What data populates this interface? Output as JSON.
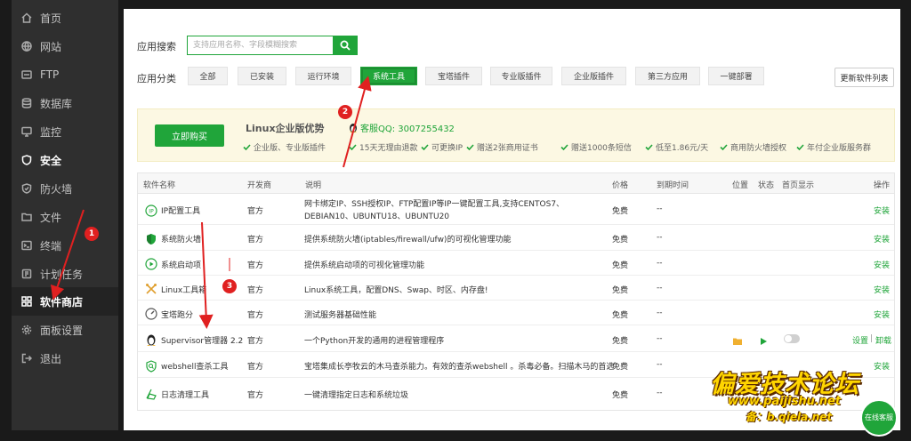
{
  "sidebar": {
    "items": [
      {
        "label": "首页",
        "icon": "home-icon"
      },
      {
        "label": "网站",
        "icon": "globe-icon"
      },
      {
        "label": "FTP",
        "icon": "ftp-icon"
      },
      {
        "label": "数据库",
        "icon": "database-icon"
      },
      {
        "label": "监控",
        "icon": "monitor-icon"
      },
      {
        "label": "安全",
        "icon": "shield-icon"
      },
      {
        "label": "防火墙",
        "icon": "firewall-icon"
      },
      {
        "label": "文件",
        "icon": "folder-icon"
      },
      {
        "label": "终端",
        "icon": "terminal-icon"
      },
      {
        "label": "计划任务",
        "icon": "clock-icon"
      },
      {
        "label": "软件商店",
        "icon": "apps-icon"
      },
      {
        "label": "面板设置",
        "icon": "gear-icon"
      },
      {
        "label": "退出",
        "icon": "logout-icon"
      }
    ],
    "active": "软件商店"
  },
  "search": {
    "label": "应用搜索",
    "placeholder": "支持应用名称、字段模糊搜索"
  },
  "categories": {
    "label": "应用分类",
    "items": [
      "全部",
      "已安装",
      "运行环境",
      "系统工具",
      "宝塔插件",
      "专业版插件",
      "企业版插件",
      "第三方应用",
      "一键部署"
    ],
    "active": "系统工具",
    "update_label": "更新软件列表"
  },
  "promo": {
    "buy_label": "立即购买",
    "title": "Linux企业版优势",
    "qq": "客服QQ: 3007255432",
    "features": [
      "企业版、专业版插件",
      "15天无理由退款",
      "可更换IP",
      "赠送2张商用证书",
      "赠送1000条短信",
      "低至1.86元/天",
      "商用防火墙授权",
      "年付企业版服务群"
    ]
  },
  "table": {
    "headers": [
      "软件名称",
      "开发商",
      "说明",
      "价格",
      "到期时间",
      "位置",
      "状态",
      "首页显示",
      "操作"
    ],
    "rows": [
      {
        "name": "IP配置工具",
        "dev": "官方",
        "desc": "网卡绑定IP、SSH授权IP、FTP配置IP等IP一键配置工具,支持CENTOS7、DEBIAN10、UBUNTU18、UBUNTU20",
        "price": "免费",
        "expire": "--",
        "op": "安装",
        "icon": "ip-icon"
      },
      {
        "name": "系统防火墙",
        "dev": "官方",
        "desc": "提供系统防火墙(iptables/firewall/ufw)的可视化管理功能",
        "price": "免费",
        "expire": "--",
        "op": "安装",
        "icon": "firewall-shield-icon"
      },
      {
        "name": "系统启动项",
        "dev": "官方",
        "desc": "提供系统启动项的可视化管理功能",
        "price": "免费",
        "expire": "--",
        "op": "安装",
        "icon": "startup-icon"
      },
      {
        "name": "Linux工具箱",
        "dev": "官方",
        "desc": "Linux系统工具，配置DNS、Swap、时区、内存盘!",
        "price": "免费",
        "expire": "--",
        "op": "安装",
        "icon": "tools-icon"
      },
      {
        "name": "宝塔跑分",
        "dev": "官方",
        "desc": "测试服务器基础性能",
        "price": "免费",
        "expire": "--",
        "op": "安装",
        "icon": "gauge-icon"
      },
      {
        "name": "Supervisor管理器 2.2",
        "dev": "官方",
        "desc": "一个Python开发的通用的进程管理程序",
        "price": "免费",
        "expire": "--",
        "op1": "设置",
        "sep": "|",
        "op2": "卸载",
        "icon": "penguin-icon"
      },
      {
        "name": "webshell查杀工具",
        "dev": "官方",
        "desc": "宝塔集成长亭牧云的木马查杀能力。有效的查杀webshell 。杀毒必备。扫描木马的首选",
        "price": "免费",
        "expire": "--",
        "op": "安装",
        "icon": "webshell-icon"
      },
      {
        "name": "日志清理工具",
        "dev": "官方",
        "desc": "一键清理指定日志和系统垃圾",
        "price": "免费",
        "expire": "--",
        "op": "",
        "icon": "broom-icon"
      }
    ]
  },
  "annotations": {
    "badge1": "1",
    "badge2": "2",
    "badge3": "3",
    "color": "#e02020"
  },
  "watermark": {
    "title": "偏爱技术论坛",
    "url": "www.paijishu.net",
    "sub": "备：b.qiela.net"
  },
  "chat": {
    "label": "在线客服"
  },
  "colors": {
    "accent": "#20a53a",
    "sidebar": "#2f2f2f",
    "promo_bg": "#fcf8e3"
  }
}
